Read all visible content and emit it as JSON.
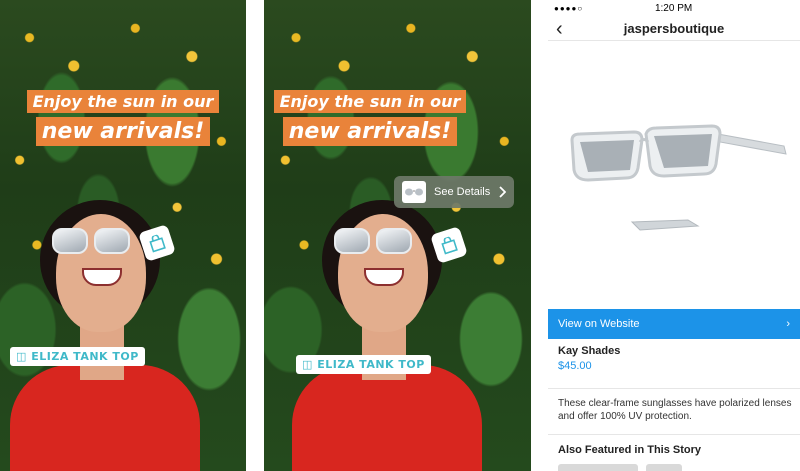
{
  "story1": {
    "headline_line1": "Enjoy the sun in our",
    "headline_line2": "new arrivals!",
    "product_tag": "ELIZA TANK TOP",
    "shopping_icon": "shopping-bag-icon"
  },
  "story2": {
    "headline_line1": "Enjoy the sun in our",
    "headline_line2": "new arrivals!",
    "product_tag": "ELIZA TANK TOP",
    "details_label": "See Details",
    "details_icon": "chevron-right-icon",
    "shopping_icon": "shopping-bag-icon"
  },
  "product_page": {
    "status_time": "1:20 PM",
    "account_name": "jaspersboutique",
    "cta_label": "View on Website",
    "product_name": "Kay Shades",
    "price": "$45.00",
    "description": "These clear-frame sunglasses have polarized lenses and offer 100% UV protection.",
    "section_title": "Also Featured in This Story"
  },
  "colors": {
    "headline_bg": "#e9833a",
    "tag_text": "#3fb9c9",
    "accent_blue": "#1c93e8",
    "shirt_red": "#d8261f"
  }
}
